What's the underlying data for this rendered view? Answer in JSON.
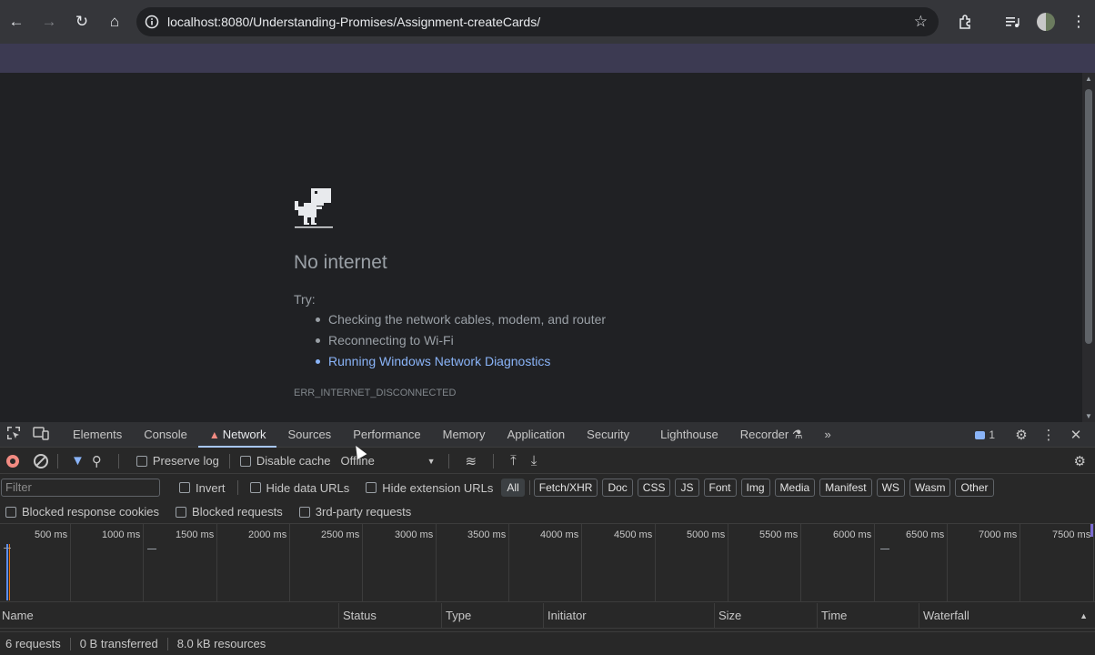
{
  "browser": {
    "url": "localhost:8080/Understanding-Promises/Assignment-createCards/"
  },
  "error_page": {
    "title": "No internet",
    "try_label": "Try:",
    "suggestions": [
      "Checking the network cables, modem, and router",
      "Reconnecting to Wi-Fi",
      "Running Windows Network Diagnostics"
    ],
    "code": "ERR_INTERNET_DISCONNECTED"
  },
  "devtools": {
    "tabs": [
      "Elements",
      "Console",
      "Network",
      "Sources",
      "Performance",
      "Memory",
      "Application",
      "Security",
      "Lighthouse",
      "Recorder"
    ],
    "active_tab": "Network",
    "issues_count": "1",
    "toolbar": {
      "preserve_log": "Preserve log",
      "disable_cache": "Disable cache",
      "throttling": "Offline"
    },
    "filter": {
      "placeholder": "Filter",
      "invert": "Invert",
      "hide_data_urls": "Hide data URLs",
      "hide_extension_urls": "Hide extension URLs",
      "types": [
        "All",
        "Fetch/XHR",
        "Doc",
        "CSS",
        "JS",
        "Font",
        "Img",
        "Media",
        "Manifest",
        "WS",
        "Wasm",
        "Other"
      ],
      "active_type": "All"
    },
    "options": {
      "blocked_cookies": "Blocked response cookies",
      "blocked_requests": "Blocked requests",
      "third_party": "3rd-party requests"
    },
    "timeline_ticks": [
      "500 ms",
      "1000 ms",
      "1500 ms",
      "2000 ms",
      "2500 ms",
      "3000 ms",
      "3500 ms",
      "4000 ms",
      "4500 ms",
      "5000 ms",
      "5500 ms",
      "6000 ms",
      "6500 ms",
      "7000 ms",
      "7500 ms"
    ],
    "columns": [
      "Name",
      "Status",
      "Type",
      "Initiator",
      "Size",
      "Time",
      "Waterfall"
    ],
    "status": {
      "requests": "6 requests",
      "transferred": "0 B transferred",
      "resources": "8.0 kB resources"
    }
  }
}
